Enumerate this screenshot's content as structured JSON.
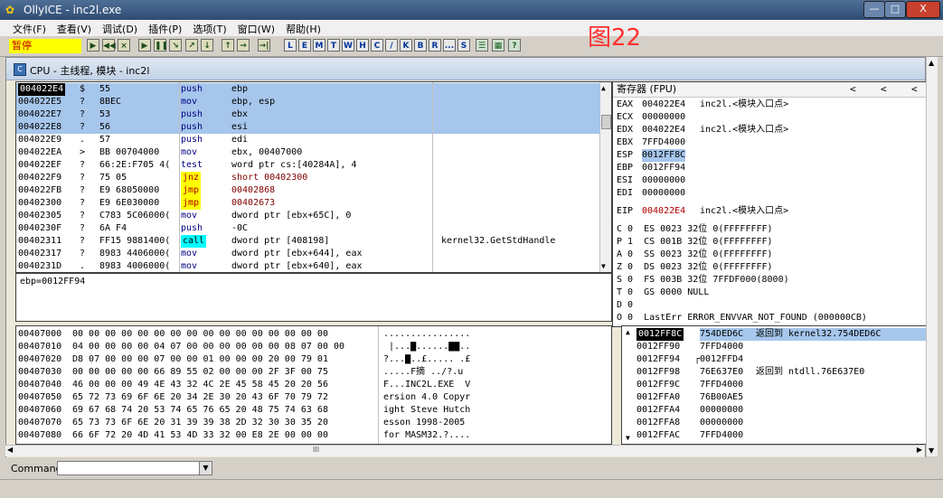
{
  "window": {
    "title": "OllyICE - inc2l.exe",
    "min_label": "—",
    "max_label": "□",
    "close_label": "X"
  },
  "menu": [
    "文件(F)",
    "查看(V)",
    "调试(D)",
    "插件(P)",
    "选项(T)",
    "窗口(W)",
    "帮助(H)"
  ],
  "status": "暂停",
  "toolbar_buttons": [
    "▶",
    "◀◀",
    "×",
    "▶",
    "❚❚",
    "↘",
    "↗",
    "↓",
    "↑",
    "→",
    "→|",
    "L",
    "E",
    "M",
    "T",
    "W",
    "H",
    "C",
    "/",
    "K",
    "B",
    "R",
    "...",
    "S",
    "☰",
    "▦",
    "?"
  ],
  "figure_label": "图22",
  "cpu_title": "CPU - 主线程, 模块 - inc2l",
  "disasm_rows": [
    {
      "addr": "004022E4",
      "mark": "$",
      "hex": "55",
      "mnem": "push",
      "op": "ebp",
      "cmt": "",
      "hl": true,
      "addrsel": true
    },
    {
      "addr": "004022E5",
      "mark": "?",
      "hex": "8BEC",
      "mnem": "mov",
      "op": "ebp, esp",
      "cmt": "",
      "hl": true
    },
    {
      "addr": "004022E7",
      "mark": "?",
      "hex": "53",
      "mnem": "push",
      "op": "ebx",
      "cmt": "",
      "hl": true
    },
    {
      "addr": "004022E8",
      "mark": "?",
      "hex": "56",
      "mnem": "push",
      "op": "esi",
      "cmt": "",
      "hl": true
    },
    {
      "addr": "004022E9",
      "mark": ".",
      "hex": "57",
      "mnem": "push",
      "op": "edi",
      "cmt": ""
    },
    {
      "addr": "004022EA",
      "mark": ">",
      "hex": "BB 00704000",
      "mnem": "mov",
      "op": "ebx, 00407000",
      "cmt": ""
    },
    {
      "addr": "004022EF",
      "mark": "?",
      "hex": "66:2E:F705 4(",
      "mnem": "test",
      "op": "word ptr cs:[40284A], 4",
      "cmt": ""
    },
    {
      "addr": "004022F9",
      "mark": "?",
      "hex": "75 05",
      "mnem": "jnz",
      "op": "short 00402300",
      "cmt": "",
      "mstyle": "jnz"
    },
    {
      "addr": "004022FB",
      "mark": "?",
      "hex": "E9 68050000",
      "mnem": "jmp",
      "op": "00402868",
      "cmt": "",
      "mstyle": "jmp"
    },
    {
      "addr": "00402300",
      "mark": "?",
      "hex": "E9 6E030000",
      "mnem": "jmp",
      "op": "00402673",
      "cmt": "",
      "mstyle": "jmp"
    },
    {
      "addr": "00402305",
      "mark": "?",
      "hex": "C783 5C06000(",
      "mnem": "mov",
      "op": "dword ptr [ebx+65C], 0",
      "cmt": ""
    },
    {
      "addr": "0040230F",
      "mark": "?",
      "hex": "6A F4",
      "mnem": "push",
      "op": "-0C",
      "cmt": ""
    },
    {
      "addr": "00402311",
      "mark": "?",
      "hex": "FF15 9881400(",
      "mnem": "call",
      "op": "dword ptr [408198]",
      "cmt": "kernel32.GetStdHandle",
      "mstyle": "call"
    },
    {
      "addr": "00402317",
      "mark": "?",
      "hex": "8983 4406000(",
      "mnem": "mov",
      "op": "dword ptr [ebx+644], eax",
      "cmt": ""
    },
    {
      "addr": "0040231D",
      "mark": ".",
      "hex": "8983 4006000(",
      "mnem": "mov",
      "op": "dword ptr [ebx+640], eax",
      "cmt": ""
    }
  ],
  "info_text": "ebp=0012FF94",
  "registers_header": "寄存器 (FPU)",
  "registers_arrows": [
    "<",
    "<",
    "<"
  ],
  "registers": [
    {
      "name": "EAX",
      "val": "004022E4",
      "note": "inc2l.<模块入口点>"
    },
    {
      "name": "ECX",
      "val": "00000000",
      "note": ""
    },
    {
      "name": "EDX",
      "val": "004022E4",
      "note": "inc2l.<模块入口点>"
    },
    {
      "name": "EBX",
      "val": "7FFD4000",
      "note": ""
    },
    {
      "name": "ESP",
      "val": "0012FF8C",
      "note": "",
      "sel": true
    },
    {
      "name": "EBP",
      "val": "0012FF94",
      "note": ""
    },
    {
      "name": "ESI",
      "val": "00000000",
      "note": ""
    },
    {
      "name": "EDI",
      "val": "00000000",
      "note": ""
    }
  ],
  "eip": {
    "name": "EIP",
    "val": "004022E4",
    "note": "inc2l.<模块入口点>"
  },
  "flags": [
    "C 0  ES 0023 32位 0(FFFFFFFF)",
    "P 1  CS 001B 32位 0(FFFFFFFF)",
    "A 0  SS 0023 32位 0(FFFFFFFF)",
    "Z 0  DS 0023 32位 0(FFFFFFFF)",
    "S 0  FS 003B 32位 7FFDF000(8000)",
    "T 0  GS 0000 NULL",
    "D 0",
    "O 0  LastErr ERROR_ENVVAR_NOT_FOUND (000000CB)"
  ],
  "dump_rows": [
    {
      "addr": "00407000",
      "hex": "00 00 00 00 00 00 00 00 00 00 00 00 00 00 00 00",
      "ascii": "................"
    },
    {
      "addr": "00407010",
      "hex": "04 00 00 00 00 04 07 00 00 00 00 00 00 08 07 00 00",
      "ascii": " |...▇......▇▇.."
    },
    {
      "addr": "00407020",
      "hex": "D8 07 00 00 00 07 00 00 01 00 00 00 20 00 79 01",
      "ascii": "?...▇..£..... .£"
    },
    {
      "addr": "00407030",
      "hex": "00 00 00 00 00 66 89 55 02 00 00 00 2F 3F 00 75",
      "ascii": ".....F摘 ../?.u"
    },
    {
      "addr": "00407040",
      "hex": "46 00 00 00 49 4E 43 32 4C 2E 45 58 45 20 20 56",
      "ascii": "F...INC2L.EXE  V"
    },
    {
      "addr": "00407050",
      "hex": "65 72 73 69 6F 6E 20 34 2E 30 20 43 6F 70 79 72",
      "ascii": "ersion 4.0 Copyr"
    },
    {
      "addr": "00407060",
      "hex": "69 67 68 74 20 53 74 65 76 65 20 48 75 74 63 68",
      "ascii": "ight Steve Hutch"
    },
    {
      "addr": "00407070",
      "hex": "65 73 73 6F 6E 20 31 39 39 38 2D 32 30 30 35 20",
      "ascii": "esson 1998-2005 "
    },
    {
      "addr": "00407080",
      "hex": "66 6F 72 20 4D 41 53 4D 33 32 00 E8 2E 00 00 00",
      "ascii": "for MASM32.?...."
    }
  ],
  "stack_rows": [
    {
      "addr": "0012FF8C",
      "val": "754DED6C",
      "note": "返回到 kernel32.754DED6C",
      "sel": true
    },
    {
      "addr": "0012FF90",
      "val": "7FFD4000",
      "note": ""
    },
    {
      "addr": "0012FF94",
      "val": "0012FFD4",
      "note": "",
      "bracket": true
    },
    {
      "addr": "0012FF98",
      "val": "76E637E0",
      "note": "返回到 ntdll.76E637E0"
    },
    {
      "addr": "0012FF9C",
      "val": "7FFD4000",
      "note": ""
    },
    {
      "addr": "0012FFA0",
      "val": "76B00AE5",
      "note": ""
    },
    {
      "addr": "0012FFA4",
      "val": "00000000",
      "note": ""
    },
    {
      "addr": "0012FFA8",
      "val": "00000000",
      "note": ""
    },
    {
      "addr": "0012FFAC",
      "val": "7FFD4000",
      "note": ""
    }
  ],
  "hscroll_grip": "III",
  "command_label": "Command",
  "command_value": "",
  "colors": {
    "highlight": "#a6c6ec",
    "jump": "#ffff00",
    "call": "#00ffff",
    "constant": "#800000",
    "flag_text": "#000000"
  }
}
